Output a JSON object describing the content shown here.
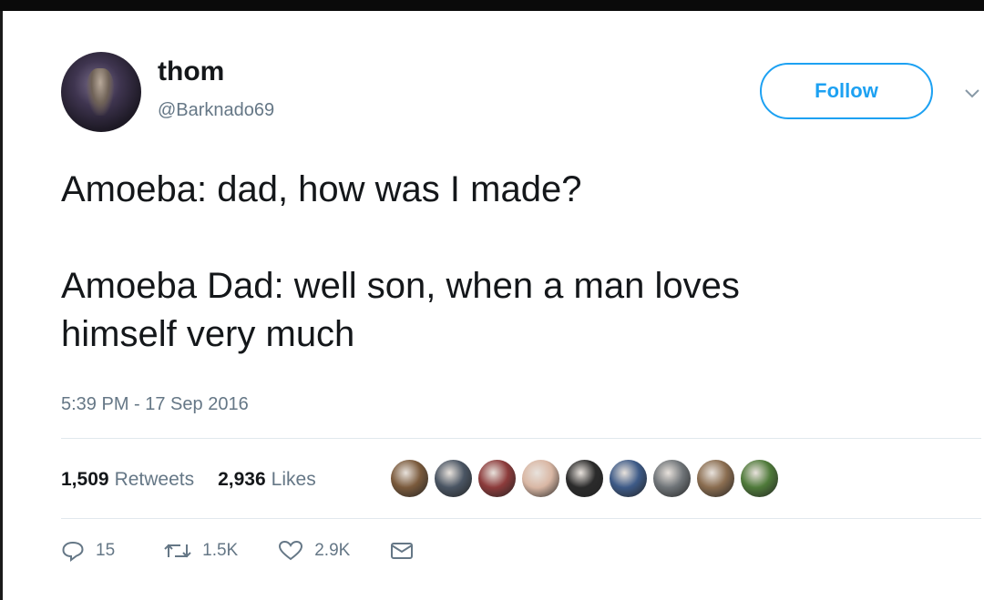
{
  "user": {
    "name": "thom",
    "handle": "@Barknado69"
  },
  "follow_label": "Follow",
  "tweet": {
    "text": "Amoeba: dad, how was I made?\n\nAmoeba Dad: well son, when a man loves\nhimself very much",
    "timestamp": "5:39 PM - 17 Sep 2016"
  },
  "stats": {
    "retweets_count": "1,509",
    "retweets_label": "Retweets",
    "likes_count": "2,936",
    "likes_label": "Likes"
  },
  "likers": [
    {
      "icon": "liker-avatar",
      "color": "#7a5a3c"
    },
    {
      "icon": "liker-avatar",
      "color": "#4a5563"
    },
    {
      "icon": "liker-avatar",
      "color": "#8c3b3b"
    },
    {
      "icon": "liker-avatar",
      "color": "#d9b7a4"
    },
    {
      "icon": "liker-avatar",
      "color": "#2b2b2b"
    },
    {
      "icon": "liker-avatar",
      "color": "#3d5a87"
    },
    {
      "icon": "liker-avatar",
      "color": "#6f7478"
    },
    {
      "icon": "liker-avatar",
      "color": "#8a6d50"
    },
    {
      "icon": "liker-avatar",
      "color": "#4f7a3a"
    }
  ],
  "actions": {
    "reply_count": "15",
    "retweet_count": "1.5K",
    "like_count": "2.9K"
  },
  "icons": {
    "reply": "reply-icon",
    "retweet": "retweet-icon",
    "like": "heart-icon",
    "dm": "envelope-icon",
    "caret": "chevron-down-icon"
  },
  "colors": {
    "accent": "#1da1f2",
    "secondary_text": "#657786"
  }
}
